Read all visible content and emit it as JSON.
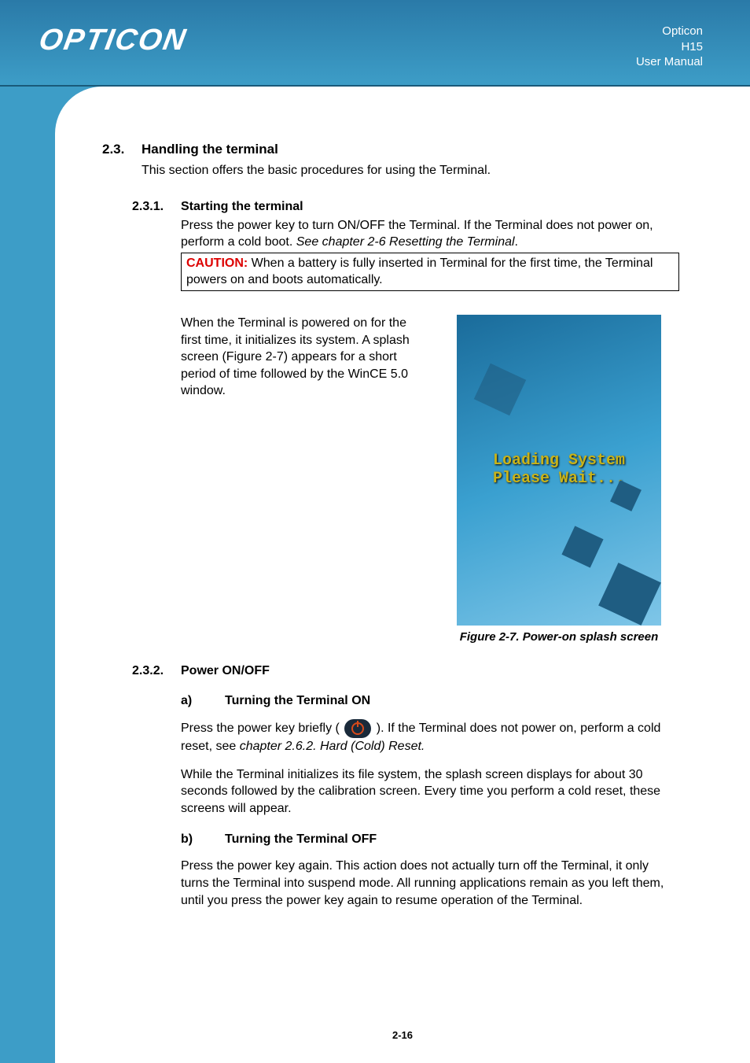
{
  "header": {
    "brand": "OPTICON",
    "line1": "Opticon",
    "line2": "H15",
    "line3": "User Manual"
  },
  "section": {
    "num": "2.3.",
    "title": "Handling the terminal",
    "intro": "This section offers the basic procedures for using the Terminal."
  },
  "sub1": {
    "num": "2.3.1.",
    "title": "Starting the terminal",
    "p1a": "Press the power key to turn ON/OFF the Terminal. If the Terminal does not power on, perform a cold boot. ",
    "p1b": "See chapter 2-6 Resetting the Terminal",
    "p1c": ".",
    "caution_label": "CAUTION:",
    "caution_text": " When a battery is fully inserted in Terminal for the first time, the Terminal powers on and boots automatically.",
    "p2": "When the Terminal is powered on for the first time, it initializes its system. A splash screen (Figure 2-7) appears for a short period of time followed by the WinCE 5.0 window.",
    "splash_l1": "Loading System",
    "splash_l2": "Please Wait...",
    "fig_caption": "Figure 2-7. Power-on splash screen"
  },
  "sub2": {
    "num": "2.3.2.",
    "title": "Power ON/OFF",
    "a_letter": "a)",
    "a_title": "Turning the Terminal ON",
    "a_p1a": "Press the power key briefly ( ",
    "a_p1b": " ). If the Terminal does not power on, perform a cold reset, see ",
    "a_p1c": "chapter 2.6.2. Hard (Cold) Reset.",
    "a_p2": "While the Terminal initializes its file system, the splash screen displays for about 30 seconds followed by the calibration screen. Every time you perform a cold reset, these screens will appear.",
    "b_letter": "b)",
    "b_title": "Turning the Terminal OFF",
    "b_p1": "Press the power key again. This action does not actually turn off the Terminal, it only turns the Terminal into suspend mode. All running applications remain as you left them, until you press the power key again to resume operation of the Terminal."
  },
  "page_number": "2-16"
}
